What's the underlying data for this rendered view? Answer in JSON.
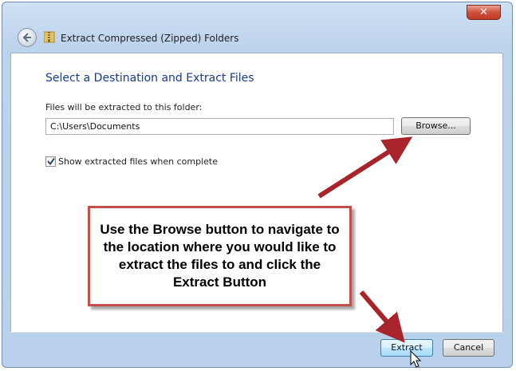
{
  "window": {
    "title": "Extract Compressed (Zipped) Folders",
    "close_glyph": "✕"
  },
  "content": {
    "heading": "Select a Destination and Extract Files",
    "path_label": "Files will be extracted to this folder:",
    "path_value": "C:\\Users\\Documents",
    "browse_label": "Browse...",
    "show_files_label": "Show extracted files when complete",
    "show_files_checked": true
  },
  "footer": {
    "extract_label": "Extract",
    "cancel_label": "Cancel"
  },
  "callout": {
    "text": "Use the Browse button to navigate to the location where you would like to extract the files to and click the Extract Button"
  },
  "colors": {
    "arrow": "#a8242a",
    "callout_border": "#c0504d",
    "heading": "#1a3a8c"
  },
  "icons": [
    "back-arrow-icon",
    "zip-folder-icon",
    "close-icon",
    "checkmark-icon",
    "mouse-cursor-icon"
  ]
}
